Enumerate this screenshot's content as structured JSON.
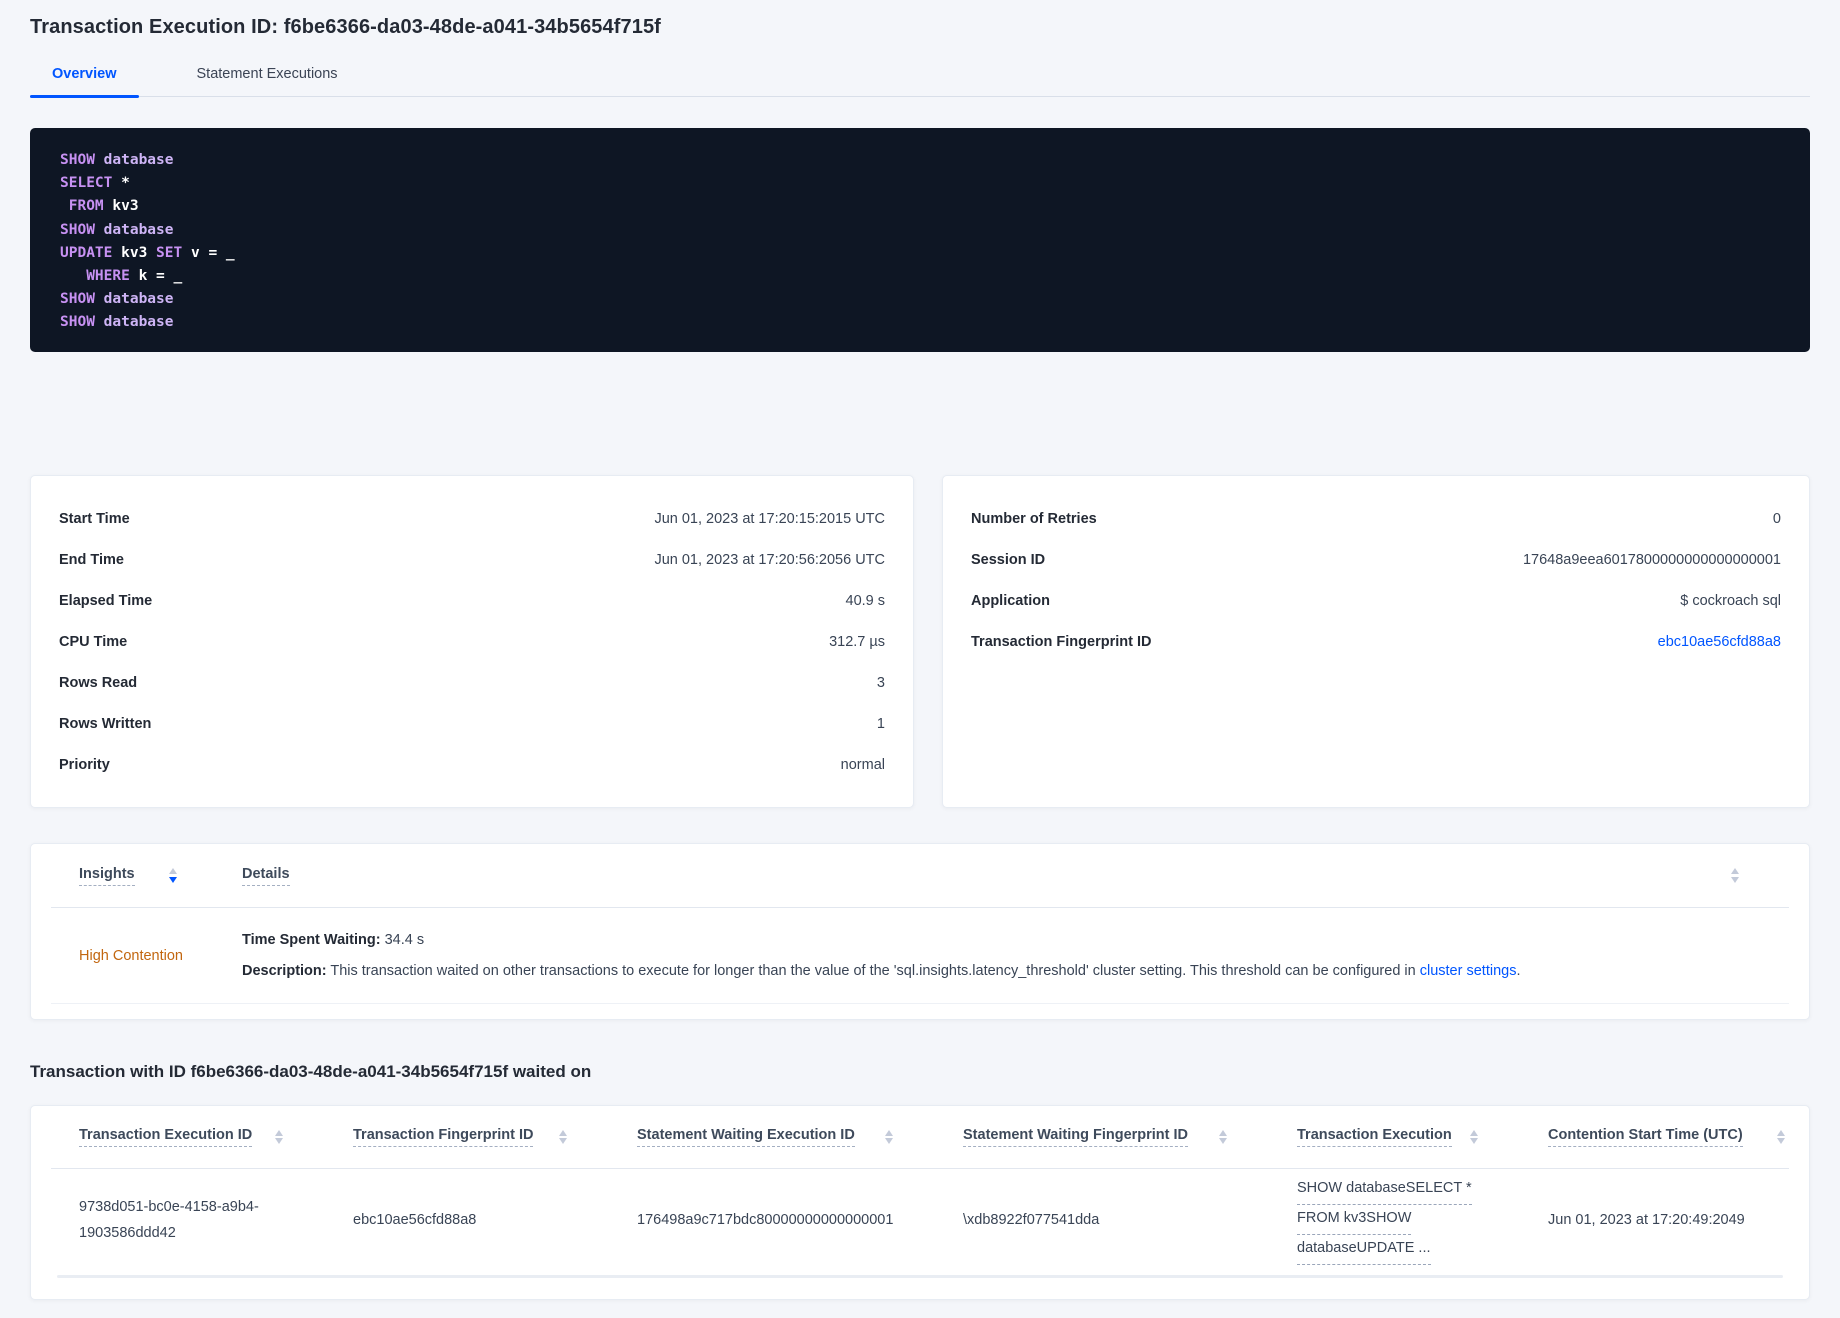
{
  "colors": {
    "accent_blue": "#0055ff",
    "insight_orange": "#c2660f",
    "code_background": "#0e1624",
    "code_keyword": "#c791f2",
    "code_keyword_secondary": "#cdb4f5",
    "code_identifier": "#ffffff"
  },
  "header": {
    "title": "Transaction Execution ID: f6be6366-da03-48de-a041-34b5654f715f"
  },
  "tabs": {
    "overview": "Overview",
    "statement_executions": "Statement Executions"
  },
  "sql": {
    "l1a": "SHOW",
    "l1b": " database",
    "l2a": "SELECT",
    "l2b": " *",
    "l3a": " FROM",
    "l3b": " kv3",
    "l4a": "SHOW",
    "l4b": " database",
    "l5a": "UPDATE",
    "l5b": " kv3 ",
    "l5c": "SET",
    "l5d": " v = _",
    "l6a": "   WHERE",
    "l6b": " k = _",
    "l7a": "SHOW",
    "l7b": " database",
    "l8a": "SHOW",
    "l8b": " database"
  },
  "exec_card": {
    "rows": [
      {
        "label": "Start Time",
        "value": "Jun 01, 2023 at 17:20:15:2015 UTC"
      },
      {
        "label": "End Time",
        "value": "Jun 01, 2023 at 17:20:56:2056 UTC"
      },
      {
        "label": "Elapsed Time",
        "value": "40.9 s"
      },
      {
        "label": "CPU Time",
        "value": "312.7 µs"
      },
      {
        "label": "Rows Read",
        "value": "3"
      },
      {
        "label": "Rows Written",
        "value": "1"
      },
      {
        "label": "Priority",
        "value": "normal"
      }
    ]
  },
  "session_card": {
    "rows": [
      {
        "label": "Number of Retries",
        "value": "0"
      },
      {
        "label": "Session ID",
        "value": "17648a9eea6017800000000000000001"
      },
      {
        "label": "Application",
        "value": "$ cockroach sql"
      }
    ],
    "fingerprint_label": "Transaction Fingerprint ID",
    "fingerprint_value": "ebc10ae56cfd88a8"
  },
  "insights": {
    "col_insights": "Insights",
    "col_details": "Details",
    "row": {
      "insight": "High Contention",
      "waiting_label": "Time Spent Waiting:",
      "waiting_value": " 34.4 s",
      "description_label": "Description:",
      "description_text": " This transaction waited on other transactions to execute for longer than the value of the 'sql.insights.latency_threshold' cluster setting. This threshold can be configured in ",
      "description_link": "cluster settings",
      "description_suffix": "."
    }
  },
  "waited_on": {
    "heading": "Transaction with ID f6be6366-da03-48de-a041-34b5654f715f waited on",
    "columns": [
      "Transaction Execution ID",
      "Transaction Fingerprint ID",
      "Statement Waiting Execution ID",
      "Statement Waiting Fingerprint ID",
      "Transaction Execution",
      "Contention Start Time (UTC)"
    ],
    "row": {
      "txn_execution_id_line1": "9738d051-bc0e-4158-a9b4-",
      "txn_execution_id_line2": "1903586ddd42",
      "txn_fingerprint_id": "ebc10ae56cfd88a8",
      "stmt_waiting_execution_id": "176498a9c717bdc80000000000000001",
      "stmt_waiting_fingerprint_id": "\\xdb8922f077541dda",
      "txn_execution_line1": "SHOW databaseSELECT *",
      "txn_execution_line2": "FROM kv3SHOW",
      "txn_execution_line3": "databaseUPDATE ...",
      "contention_start_time": "Jun 01, 2023 at 17:20:49:2049"
    }
  }
}
